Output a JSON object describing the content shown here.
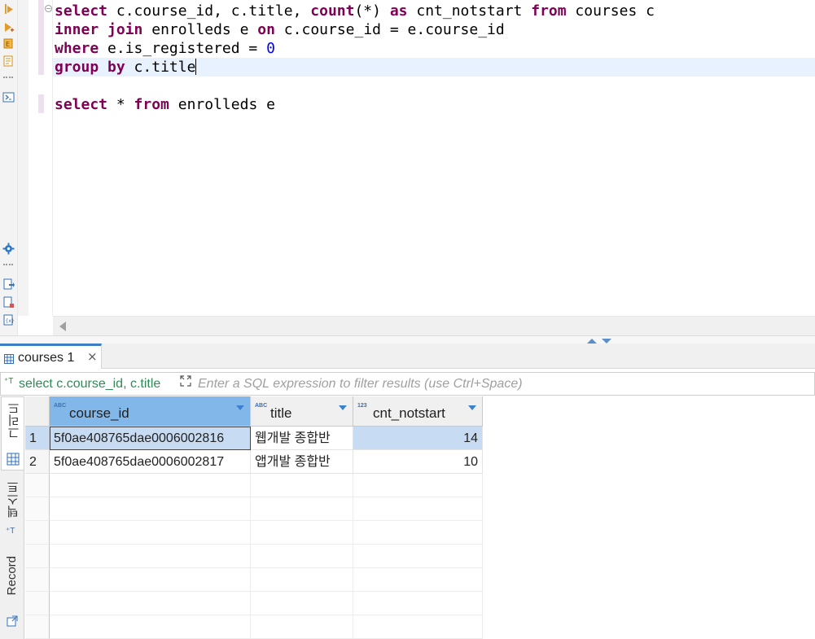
{
  "editor": {
    "lines": [
      [
        {
          "t": "select",
          "k": "kw"
        },
        {
          "t": " c.course_id, c.title, "
        },
        {
          "t": "count",
          "k": "kw"
        },
        {
          "t": "(*) "
        },
        {
          "t": "as",
          "k": "kw"
        },
        {
          "t": " cnt_notstart "
        },
        {
          "t": "from",
          "k": "kw"
        },
        {
          "t": " courses c"
        }
      ],
      [
        {
          "t": "inner",
          "k": "kw"
        },
        {
          "t": " "
        },
        {
          "t": "join",
          "k": "kw"
        },
        {
          "t": " enrolleds e "
        },
        {
          "t": "on",
          "k": "kw"
        },
        {
          "t": " c.course_id = e.course_id"
        }
      ],
      [
        {
          "t": "where",
          "k": "kw"
        },
        {
          "t": " e.is_registered = "
        },
        {
          "t": "0",
          "k": "num"
        }
      ],
      [
        {
          "t": "group",
          "k": "kw"
        },
        {
          "t": " "
        },
        {
          "t": "by",
          "k": "kw"
        },
        {
          "t": " c.title"
        }
      ],
      [],
      [
        {
          "t": "select",
          "k": "kw"
        },
        {
          "t": " * "
        },
        {
          "t": "from",
          "k": "kw"
        },
        {
          "t": " enrolleds e"
        }
      ]
    ],
    "current_line": 3
  },
  "results": {
    "tab_label": "courses 1",
    "tab_close": "×",
    "filter_query": "select c.course_id, c.title",
    "filter_placeholder": "Enter a SQL expression to filter results (use Ctrl+Space)",
    "side_tabs": {
      "grid": "그리드",
      "text": "텍스트",
      "record": "Record"
    },
    "columns": [
      {
        "name": "course_id",
        "type_badge": "ABC"
      },
      {
        "name": "title",
        "type_badge": "ABC"
      },
      {
        "name": "cnt_notstart",
        "type_badge": "123"
      }
    ],
    "rows": [
      {
        "num": "1",
        "course_id": "5f0ae408765dae0006002816",
        "title": "웹개발 종합반",
        "cnt_notstart": "14"
      },
      {
        "num": "2",
        "course_id": "5f0ae408765dae0006002817",
        "title": "앱개발 종합반",
        "cnt_notstart": "10"
      }
    ]
  },
  "colors": {
    "keyword": "#7f0055",
    "number": "#0000ff",
    "selection": "#c7dcf2",
    "header_selected": "#82b8e9",
    "tab_accent": "#3c7fc4"
  },
  "icons": [
    "run-statement-icon",
    "run-script-icon",
    "explain-plan-icon",
    "terminal-icon",
    "settings-gear-icon",
    "export-icon",
    "new-script-icon",
    "file-icon",
    "grid-icon",
    "text-icon",
    "record-icon",
    "expand-icon",
    "close-icon"
  ]
}
